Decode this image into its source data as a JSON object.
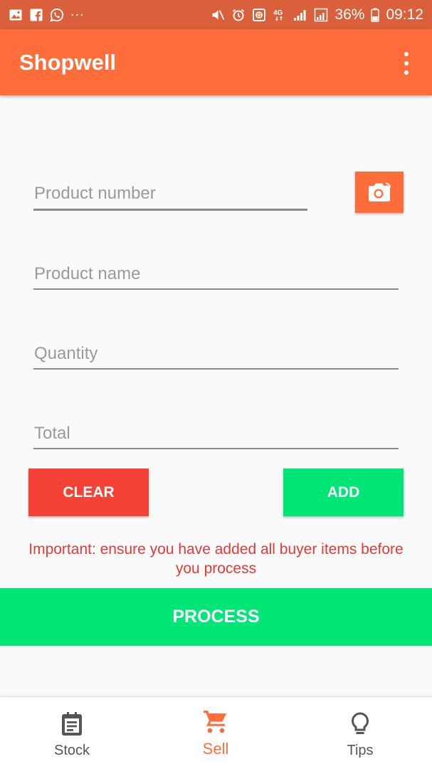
{
  "status_bar": {
    "left_icons": [
      "image-icon",
      "facebook-icon",
      "whatsapp-icon"
    ],
    "more": "...",
    "network": "4G",
    "battery": "36%",
    "time": "09:12"
  },
  "app_bar": {
    "title": "Shopwell",
    "menu_icon": "overflow-menu-icon"
  },
  "form": {
    "product_number_placeholder": "Product number",
    "product_name_placeholder": "Product name",
    "quantity_placeholder": "Quantity",
    "total_placeholder": "Total",
    "camera_icon": "camera-icon"
  },
  "buttons": {
    "clear": "CLEAR",
    "add": "ADD",
    "process": "PROCESS"
  },
  "warning": "Important: ensure you have added all buyer items before you process",
  "bottom_nav": [
    {
      "label": "Stock",
      "icon": "clipboard-icon",
      "active": false
    },
    {
      "label": "Sell",
      "icon": "cart-icon",
      "active": true
    },
    {
      "label": "Tips",
      "icon": "lightbulb-icon",
      "active": false
    }
  ],
  "colors": {
    "accent": "#ff6e3a",
    "status_bar": "#d9603a",
    "clear": "#f44336",
    "add": "#00e676",
    "warning": "#e53935"
  }
}
